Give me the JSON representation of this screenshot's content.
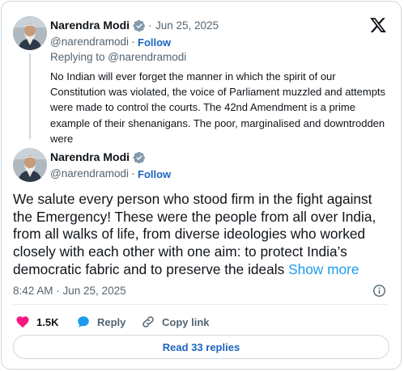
{
  "quoted_tweet": {
    "author_name": "Narendra Modi",
    "date": "Jun 25, 2025",
    "separator": "·",
    "handle": "@narendramodi",
    "follow_label": "Follow",
    "replying_to": "Replying to @narendramodi",
    "text": "No Indian will ever forget the manner in which the spirit of our Constitution was violated, the voice of Parliament muzzled and attempts were made to control the courts. The 42nd Amendment is a prime example of their shenanigans. The poor, marginalised and downtrodden were"
  },
  "main_tweet": {
    "author_name": "Narendra Modi",
    "handle": "@narendramodi",
    "separator": "·",
    "follow_label": "Follow",
    "text": "We salute every person who stood firm in the fight against the Emergency! These were the people from all over India, from all walks of life, from diverse ideologies who worked closely with each other with one aim: to protect India’s democratic fabric and to preserve the ideals",
    "show_more_label": "Show more",
    "timestamp": "8:42 AM · Jun 25, 2025"
  },
  "actions": {
    "likes": "1.5K",
    "reply_label": "Reply",
    "copy_link_label": "Copy link"
  },
  "read_replies_label": "Read 33 replies",
  "colors": {
    "link": "#1d63c1",
    "show_more": "#1d9bf0",
    "verified": "#829aab",
    "like_heart": "#f91880",
    "reply_bubble": "#1d9bf0"
  }
}
